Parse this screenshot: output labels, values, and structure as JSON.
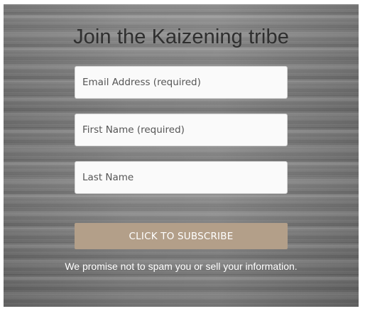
{
  "form": {
    "title": "Join the Kaizening tribe",
    "email_placeholder": "Email Address (required)",
    "first_name_placeholder": "First Name (required)",
    "last_name_placeholder": "Last Name",
    "subscribe_label": "CLICK TO SUBSCRIBE",
    "privacy_note": "We promise not to spam you or sell your information."
  },
  "colors": {
    "panel_background": "#7f7f7f",
    "button": "#b39f89",
    "title_text": "#2f2f2f",
    "note_text": "#ffffff"
  }
}
